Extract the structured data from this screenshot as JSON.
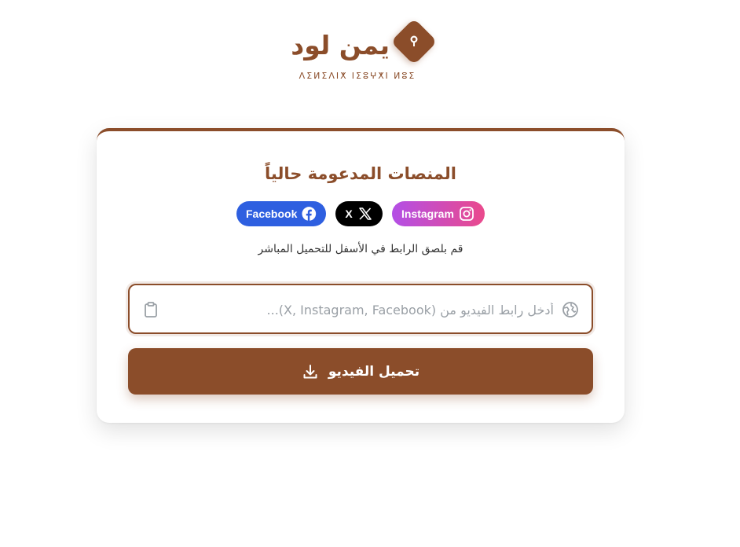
{
  "brand": {
    "name": "يمن لود",
    "tagline": "ⴷⵉⵍⵉⴷⵏⵅ ⵏⵉⵓⵖⵅⵏ ⵍⵓⵉ",
    "accent_color": "#8b4d2a",
    "logo_icon": "keyhole-icon"
  },
  "card": {
    "title": "المنصات المدعومة حالياً",
    "platforms": [
      {
        "label": "Facebook",
        "icon": "facebook-icon",
        "color": "#2e5fe0"
      },
      {
        "label": "X",
        "icon": "x-icon",
        "color": "#000000"
      },
      {
        "label": "Instagram",
        "icon": "instagram-icon",
        "color": "#c44fd2"
      }
    ],
    "helper_text": "قم بلصق الرابط في الأسفل للتحميل المباشر",
    "url_input": {
      "placeholder": "أدخل رابط الفيديو من (X, Instagram, Facebook)...",
      "value": ""
    },
    "download_button": "تحميل الفيديو"
  }
}
